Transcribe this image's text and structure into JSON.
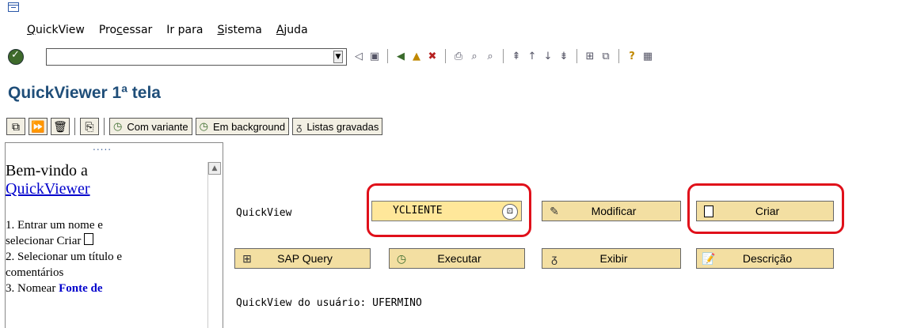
{
  "menu": {
    "items": [
      {
        "label": "QuickView",
        "u": "Q"
      },
      {
        "label": "Processar",
        "u": "c"
      },
      {
        "label": "Ir para",
        "u": ""
      },
      {
        "label": "Sistema",
        "u": "S"
      },
      {
        "label": "Ajuda",
        "u": "A"
      }
    ]
  },
  "toolbar": {
    "command_value": "",
    "icons": [
      "back-icon",
      "save-icon",
      "exit-icon",
      "up-icon",
      "cancel-icon",
      "print-icon",
      "find-icon",
      "find-next-icon",
      "first-page-icon",
      "prev-page-icon",
      "next-page-icon",
      "last-page-icon",
      "new-session-icon",
      "shortcut-icon",
      "help-icon",
      "layout-icon"
    ]
  },
  "title": "QuickViewer 1ª tela",
  "app_toolbar": {
    "com_variante": "Com variante",
    "em_background": "Em background",
    "listas_gravadas": "Listas gravadas"
  },
  "left_panel": {
    "dots": ".....",
    "welcome": "Bem-vindo a",
    "link": "QuickViewer",
    "step1a": "1. Entrar um nome e",
    "step1b": "selecionar Criar",
    "step2a": "2. Selecionar um título e",
    "step2b": "comentários",
    "step3": "3. Nomear",
    "step3_link": "Fonte de"
  },
  "main": {
    "quickview_label": "QuickView",
    "quickview_value": "YCLIENTE",
    "modificar": "Modificar",
    "criar": "Criar",
    "sap_query": "SAP Query",
    "executar": "Executar",
    "exibir": "Exibir",
    "descricao": "Descrição",
    "user_text": "QuickView do usuário: UFERMINO"
  },
  "colors": {
    "title": "#1f4e79",
    "input_bg": "#ffe79a",
    "button_bg": "#f3dfa2",
    "highlight": "#e0101a"
  }
}
